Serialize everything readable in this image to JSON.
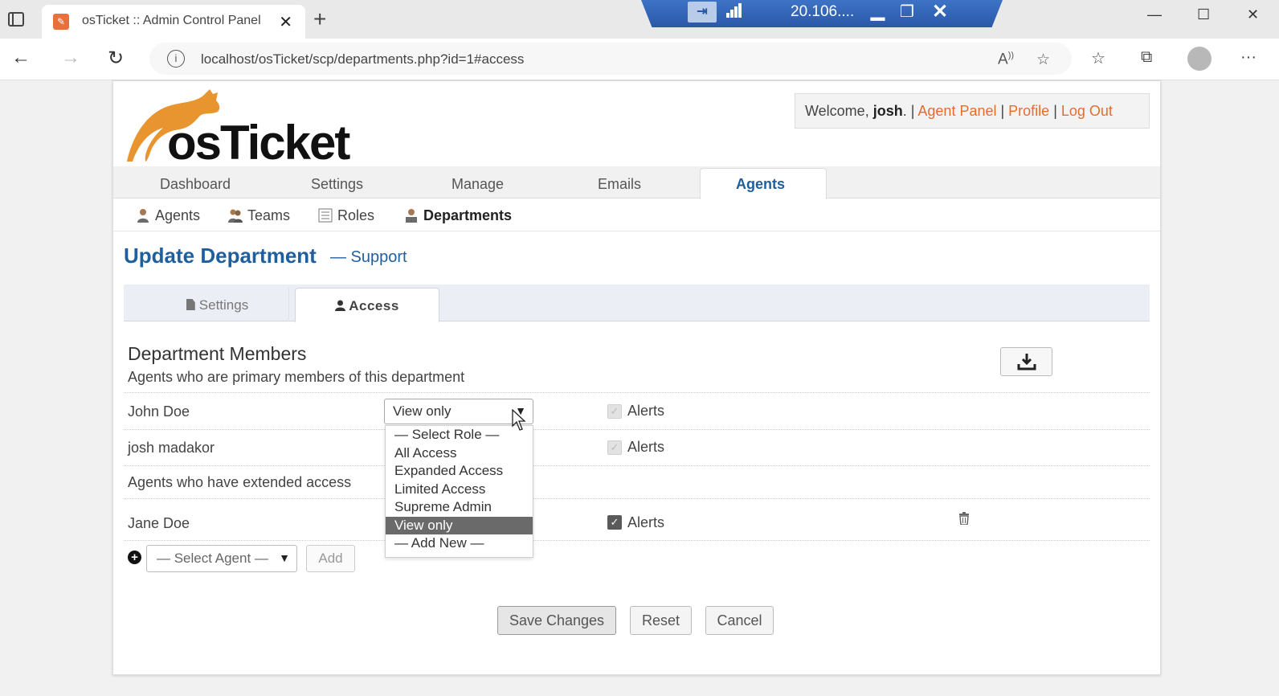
{
  "browser": {
    "tab_title": "osTicket :: Admin Control Panel",
    "tab_close": "✕",
    "new_tab": "+",
    "url": "localhost/osTicket/scp/departments.php?id=1#access",
    "remote_session_label": "20.106....",
    "read_aloud_label": "Á́"
  },
  "header": {
    "logo_text": "osTicket",
    "welcome_prefix": "Welcome, ",
    "username": "josh",
    "welcome_suffix": ". | ",
    "agent_panel": "Agent Panel",
    "sep": " | ",
    "profile": "Profile",
    "logout": "Log Out"
  },
  "main_nav": [
    "Dashboard",
    "Settings",
    "Manage",
    "Emails",
    "Agents"
  ],
  "sub_nav": [
    "Agents",
    "Teams",
    "Roles",
    "Departments"
  ],
  "page": {
    "title": "Update Department",
    "subtitle": "— Support"
  },
  "tabs": {
    "settings": "Settings",
    "access": "Access"
  },
  "members": {
    "heading": "Department Members",
    "primary_sub": "Agents who are primary members of this department",
    "extended_sub": "Agents who have extended access",
    "primary": [
      {
        "name": "John Doe",
        "role": "View only",
        "alerts_label": "Alerts",
        "alerts_checked": true
      },
      {
        "name": "josh madakor",
        "alerts_label": "Alerts",
        "alerts_checked": true
      }
    ],
    "extended": [
      {
        "name": "Jane Doe",
        "alerts_label": "Alerts",
        "alerts_checked": true
      }
    ]
  },
  "role_options": [
    "— Select Role —",
    "All Access",
    "Expanded Access",
    "Limited Access",
    "Supreme Admin",
    "View only",
    "— Add New —"
  ],
  "role_selected": "View only",
  "add_agent": {
    "placeholder": "— Select Agent —",
    "button": "Add"
  },
  "actions": {
    "save": "Save Changes",
    "reset": "Reset",
    "cancel": "Cancel"
  },
  "colors": {
    "brand_blue": "#1f5f9e",
    "link_orange": "#e46d2e",
    "logo_orange": "#e8952f"
  }
}
